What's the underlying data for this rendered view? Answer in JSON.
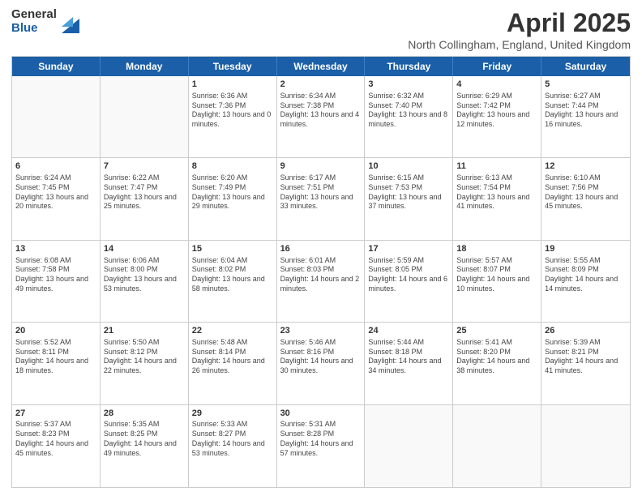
{
  "logo": {
    "general": "General",
    "blue": "Blue"
  },
  "title": "April 2025",
  "subtitle": "North Collingham, England, United Kingdom",
  "days_of_week": [
    "Sunday",
    "Monday",
    "Tuesday",
    "Wednesday",
    "Thursday",
    "Friday",
    "Saturday"
  ],
  "weeks": [
    [
      {
        "day": "",
        "empty": true
      },
      {
        "day": "",
        "empty": true
      },
      {
        "day": "1",
        "info": "Sunrise: 6:36 AM\nSunset: 7:36 PM\nDaylight: 13 hours and 0 minutes."
      },
      {
        "day": "2",
        "info": "Sunrise: 6:34 AM\nSunset: 7:38 PM\nDaylight: 13 hours and 4 minutes."
      },
      {
        "day": "3",
        "info": "Sunrise: 6:32 AM\nSunset: 7:40 PM\nDaylight: 13 hours and 8 minutes."
      },
      {
        "day": "4",
        "info": "Sunrise: 6:29 AM\nSunset: 7:42 PM\nDaylight: 13 hours and 12 minutes."
      },
      {
        "day": "5",
        "info": "Sunrise: 6:27 AM\nSunset: 7:44 PM\nDaylight: 13 hours and 16 minutes."
      }
    ],
    [
      {
        "day": "6",
        "info": "Sunrise: 6:24 AM\nSunset: 7:45 PM\nDaylight: 13 hours and 20 minutes."
      },
      {
        "day": "7",
        "info": "Sunrise: 6:22 AM\nSunset: 7:47 PM\nDaylight: 13 hours and 25 minutes."
      },
      {
        "day": "8",
        "info": "Sunrise: 6:20 AM\nSunset: 7:49 PM\nDaylight: 13 hours and 29 minutes."
      },
      {
        "day": "9",
        "info": "Sunrise: 6:17 AM\nSunset: 7:51 PM\nDaylight: 13 hours and 33 minutes."
      },
      {
        "day": "10",
        "info": "Sunrise: 6:15 AM\nSunset: 7:53 PM\nDaylight: 13 hours and 37 minutes."
      },
      {
        "day": "11",
        "info": "Sunrise: 6:13 AM\nSunset: 7:54 PM\nDaylight: 13 hours and 41 minutes."
      },
      {
        "day": "12",
        "info": "Sunrise: 6:10 AM\nSunset: 7:56 PM\nDaylight: 13 hours and 45 minutes."
      }
    ],
    [
      {
        "day": "13",
        "info": "Sunrise: 6:08 AM\nSunset: 7:58 PM\nDaylight: 13 hours and 49 minutes."
      },
      {
        "day": "14",
        "info": "Sunrise: 6:06 AM\nSunset: 8:00 PM\nDaylight: 13 hours and 53 minutes."
      },
      {
        "day": "15",
        "info": "Sunrise: 6:04 AM\nSunset: 8:02 PM\nDaylight: 13 hours and 58 minutes."
      },
      {
        "day": "16",
        "info": "Sunrise: 6:01 AM\nSunset: 8:03 PM\nDaylight: 14 hours and 2 minutes."
      },
      {
        "day": "17",
        "info": "Sunrise: 5:59 AM\nSunset: 8:05 PM\nDaylight: 14 hours and 6 minutes."
      },
      {
        "day": "18",
        "info": "Sunrise: 5:57 AM\nSunset: 8:07 PM\nDaylight: 14 hours and 10 minutes."
      },
      {
        "day": "19",
        "info": "Sunrise: 5:55 AM\nSunset: 8:09 PM\nDaylight: 14 hours and 14 minutes."
      }
    ],
    [
      {
        "day": "20",
        "info": "Sunrise: 5:52 AM\nSunset: 8:11 PM\nDaylight: 14 hours and 18 minutes."
      },
      {
        "day": "21",
        "info": "Sunrise: 5:50 AM\nSunset: 8:12 PM\nDaylight: 14 hours and 22 minutes."
      },
      {
        "day": "22",
        "info": "Sunrise: 5:48 AM\nSunset: 8:14 PM\nDaylight: 14 hours and 26 minutes."
      },
      {
        "day": "23",
        "info": "Sunrise: 5:46 AM\nSunset: 8:16 PM\nDaylight: 14 hours and 30 minutes."
      },
      {
        "day": "24",
        "info": "Sunrise: 5:44 AM\nSunset: 8:18 PM\nDaylight: 14 hours and 34 minutes."
      },
      {
        "day": "25",
        "info": "Sunrise: 5:41 AM\nSunset: 8:20 PM\nDaylight: 14 hours and 38 minutes."
      },
      {
        "day": "26",
        "info": "Sunrise: 5:39 AM\nSunset: 8:21 PM\nDaylight: 14 hours and 41 minutes."
      }
    ],
    [
      {
        "day": "27",
        "info": "Sunrise: 5:37 AM\nSunset: 8:23 PM\nDaylight: 14 hours and 45 minutes."
      },
      {
        "day": "28",
        "info": "Sunrise: 5:35 AM\nSunset: 8:25 PM\nDaylight: 14 hours and 49 minutes."
      },
      {
        "day": "29",
        "info": "Sunrise: 5:33 AM\nSunset: 8:27 PM\nDaylight: 14 hours and 53 minutes."
      },
      {
        "day": "30",
        "info": "Sunrise: 5:31 AM\nSunset: 8:28 PM\nDaylight: 14 hours and 57 minutes."
      },
      {
        "day": "",
        "empty": true
      },
      {
        "day": "",
        "empty": true
      },
      {
        "day": "",
        "empty": true
      }
    ]
  ]
}
